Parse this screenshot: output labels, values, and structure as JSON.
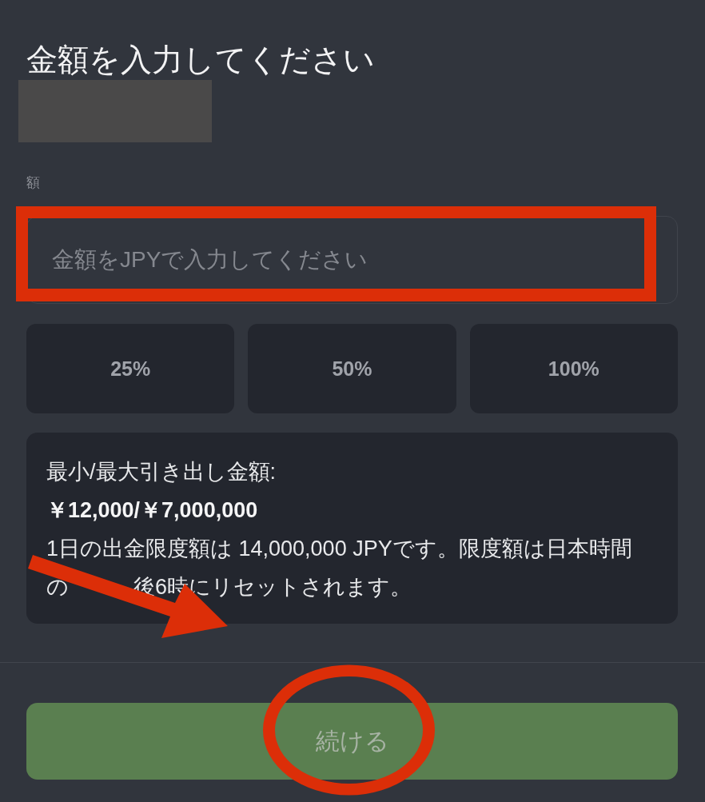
{
  "title": "金額を入力してください",
  "redacted_block": true,
  "amount_field": {
    "label": "額",
    "placeholder": "金額をJPYで入力してください"
  },
  "quick_amounts": [
    "25%",
    "50%",
    "100%"
  ],
  "info": {
    "limits_label": "最小/最大引き出し金額:",
    "limits_value": "￥12,000/￥7,000,000",
    "note": {
      "first_line": "1日の出金限度額は 14,000,000 JPYです。限度額は日本時間",
      "second_line_visible_parts": [
        "の",
        "後6時にリセットされます。"
      ]
    }
  },
  "continue_button": {
    "label": "続ける",
    "disabled": true
  },
  "annotations": [
    {
      "kind": "rectangle"
    },
    {
      "kind": "arrow"
    },
    {
      "kind": "ellipse"
    }
  ]
}
